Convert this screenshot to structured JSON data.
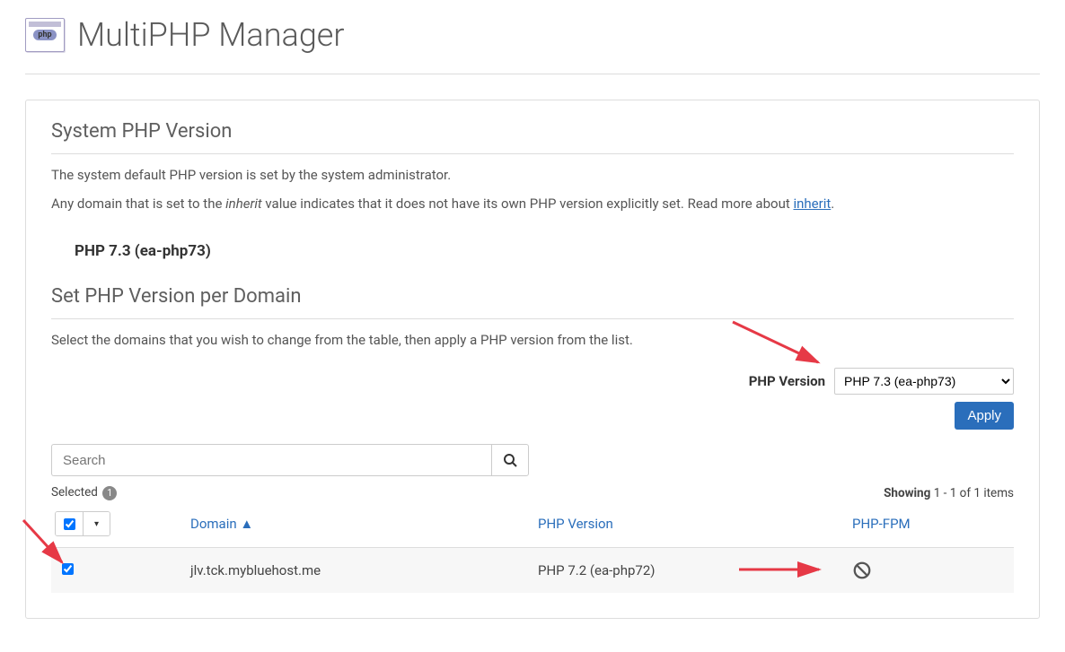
{
  "header": {
    "title": "MultiPHP Manager",
    "icon_badge": "php"
  },
  "section1": {
    "heading": "System PHP Version",
    "text1": "The system default PHP version is set by the system administrator.",
    "text2_pre": "Any domain that is set to the ",
    "text2_em": "inherit",
    "text2_mid": " value indicates that it does not have its own PHP version explicitly set. Read more about ",
    "text2_link": "inherit",
    "text2_post": ".",
    "version": "PHP 7.3 (ea-php73)"
  },
  "section2": {
    "heading": "Set PHP Version per Domain",
    "text": "Select the domains that you wish to change from the table, then apply a PHP version from the list.",
    "version_label": "PHP Version",
    "selected_version": "PHP 7.3 (ea-php73)",
    "apply_label": "Apply"
  },
  "search": {
    "placeholder": "Search"
  },
  "status": {
    "selected_label": "Selected",
    "selected_count": "1",
    "showing_label": "Showing",
    "showing_text": "1 - 1 of 1 items"
  },
  "table": {
    "headers": {
      "domain": "Domain",
      "sort_indicator": "▲",
      "php_version": "PHP Version",
      "php_fpm": "PHP-FPM"
    },
    "rows": [
      {
        "checked": true,
        "domain": "jlv.tck.mybluehost.me",
        "version": "PHP 7.2 (ea-php72)",
        "fpm": "disabled"
      }
    ]
  }
}
